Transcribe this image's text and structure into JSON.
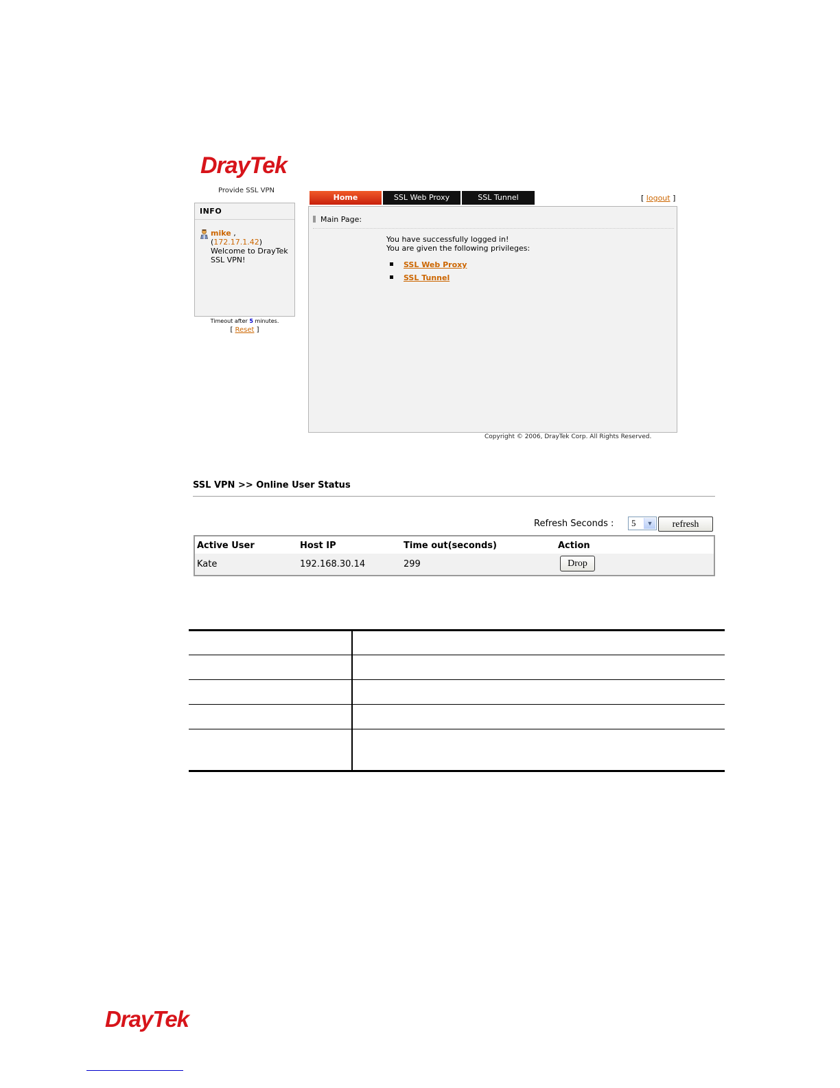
{
  "brand": {
    "logo_dray": "Dray",
    "logo_tek": "Tek",
    "tagline": "Provide SSL VPN",
    "color": "#d7141a"
  },
  "info": {
    "title": "INFO",
    "user_icon": "user-icon",
    "username": "mike",
    "username_suffix": " ,",
    "ip_open": "(",
    "ip": "172.17.1.42",
    "ip_close": ")",
    "welcome": "Welcome to DrayTek SSL VPN!"
  },
  "timeout": {
    "prefix": "Timeout after ",
    "value": "5",
    "suffix": " minutes.",
    "reset_open": "[ ",
    "reset_label": "Reset",
    "reset_close": " ]"
  },
  "tabs": {
    "home": "Home",
    "proxy": "SSL Web Proxy",
    "tunnel": "SSL Tunnel"
  },
  "logout": {
    "open": "[ ",
    "label": "logout",
    "close": " ]"
  },
  "main": {
    "header": "Main Page:",
    "line1": "You have successfully logged in!",
    "line2": "You are given the following privileges:",
    "privileges": [
      "SSL Web Proxy",
      "SSL Tunnel"
    ]
  },
  "copyright": "Copyright © 2006, DrayTek Corp. All Rights Reserved.",
  "status": {
    "title": "SSL VPN >> Online User Status",
    "refresh_label": "Refresh Seconds :",
    "refresh_value": "5",
    "refresh_button": "refresh",
    "columns": [
      "Active User",
      "Host IP",
      "Time out(seconds)",
      "Action"
    ],
    "rows": [
      {
        "user": "Kate",
        "host_ip": "192.168.30.14",
        "timeout": "299",
        "action": "Drop"
      }
    ]
  },
  "colors": {
    "link_orange": "#cc6600",
    "tab_active": "#e23a18",
    "tab_inactive": "#111111",
    "panel_bg": "#f2f2f2"
  }
}
